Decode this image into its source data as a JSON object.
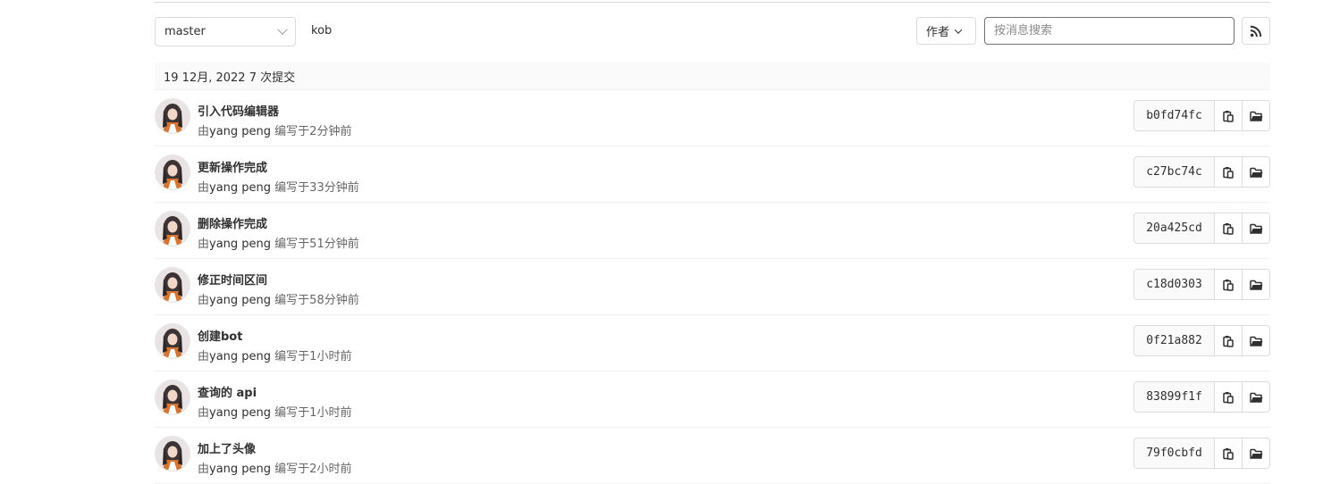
{
  "branch": {
    "selected": "master"
  },
  "project": {
    "name": "kob"
  },
  "filters": {
    "author_label": "作者",
    "search_placeholder": "按消息搜索"
  },
  "day_group": {
    "label": "19 12月, 2022 7 次提交"
  },
  "commits": [
    {
      "title": "引入代码编辑器",
      "author_prefix": "由",
      "author": "yang peng",
      "time": " 编写于2分钟前",
      "sha": "b0fd74fc"
    },
    {
      "title": "更新操作完成",
      "author_prefix": "由",
      "author": "yang peng",
      "time": " 编写于33分钟前",
      "sha": "c27bc74c"
    },
    {
      "title": "删除操作完成",
      "author_prefix": "由",
      "author": "yang peng",
      "time": " 编写于51分钟前",
      "sha": "20a425cd"
    },
    {
      "title": "修正时间区间",
      "author_prefix": "由",
      "author": "yang peng",
      "time": " 编写于58分钟前",
      "sha": "c18d0303"
    },
    {
      "title": "创建bot",
      "author_prefix": "由",
      "author": "yang peng",
      "time": " 编写于1小时前",
      "sha": "0f21a882"
    },
    {
      "title": "查询的 api",
      "author_prefix": "由",
      "author": "yang peng",
      "time": " 编写于1小时前",
      "sha": "83899f1f"
    },
    {
      "title": "加上了头像",
      "author_prefix": "由",
      "author": "yang peng",
      "time": " 编写于2小时前",
      "sha": "79f0cbfd"
    }
  ],
  "icons": {
    "branch_chevron": "chevron-down-icon",
    "author_chevron": "chevron-down-icon",
    "rss": "rss-icon",
    "copy": "clipboard-icon",
    "browse": "folder-icon",
    "avatar": "avatar"
  }
}
